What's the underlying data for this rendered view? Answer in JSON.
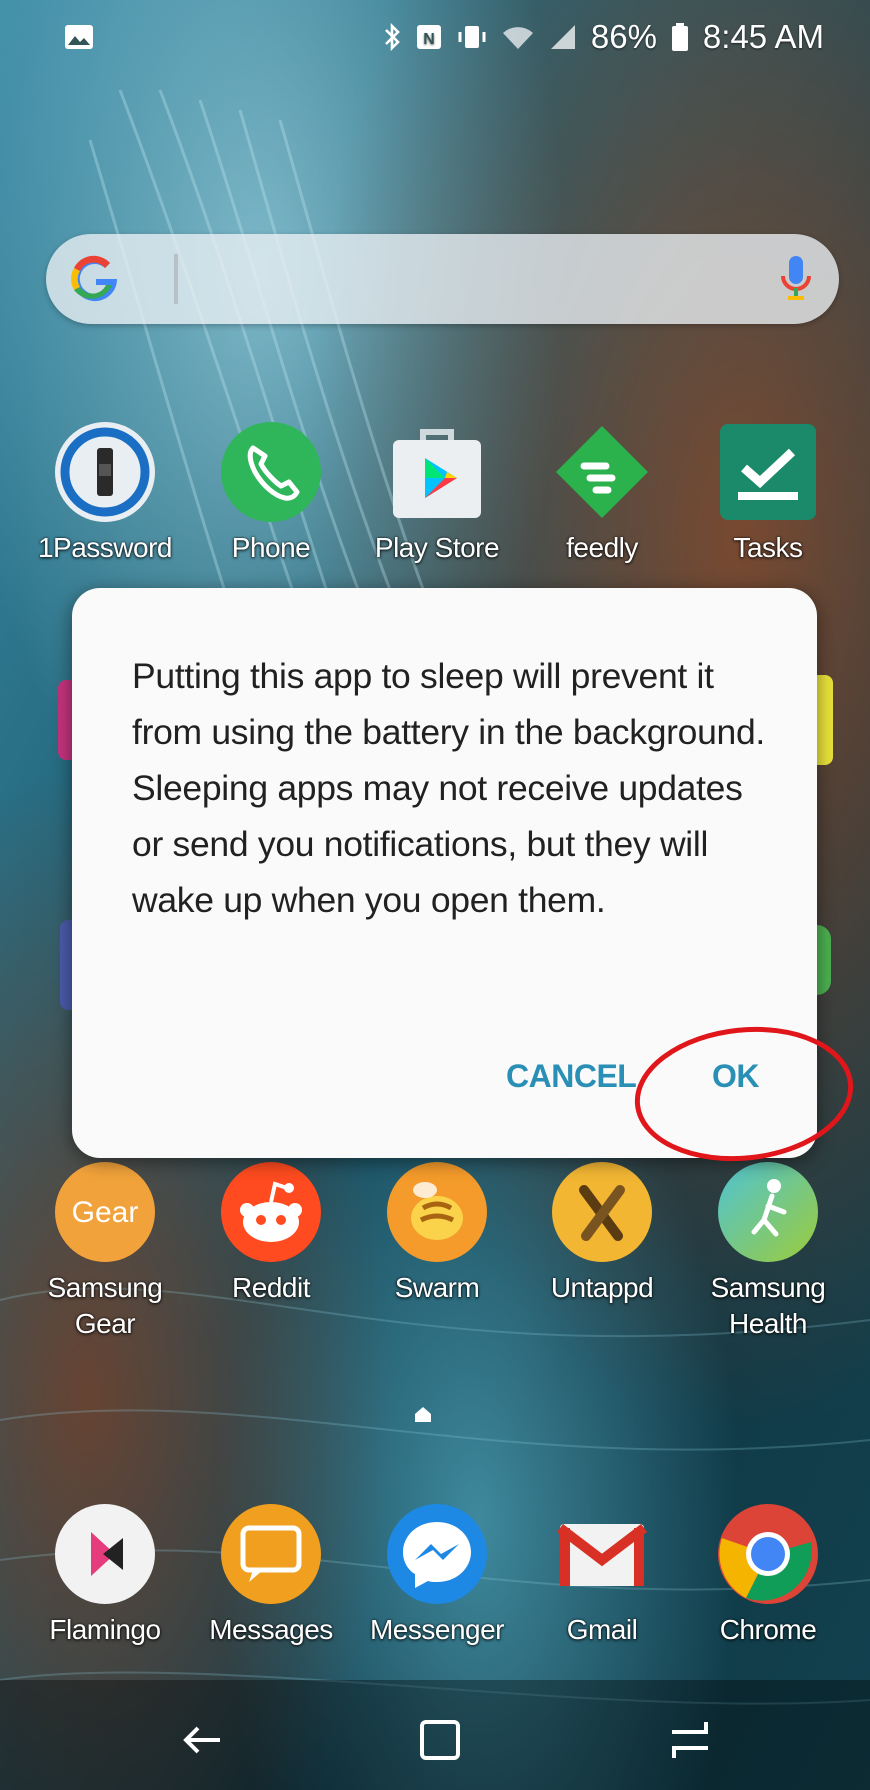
{
  "status_bar": {
    "battery": "86%",
    "time": "8:45 AM",
    "icons": [
      "picture-icon",
      "bluetooth-icon",
      "nfc-icon",
      "vibrate-icon",
      "wifi-icon",
      "signal-icon",
      "battery-icon"
    ]
  },
  "search": {
    "left_icon": "google-g-icon",
    "right_icon": "mic-icon"
  },
  "apps": {
    "row1": [
      {
        "label": "1Password",
        "icon": "onepassword-icon"
      },
      {
        "label": "Phone",
        "icon": "phone-icon"
      },
      {
        "label": "Play Store",
        "icon": "play-store-icon"
      },
      {
        "label": "feedly",
        "icon": "feedly-icon"
      },
      {
        "label": "Tasks",
        "icon": "tasks-icon"
      }
    ],
    "row4": [
      {
        "label": "Samsung Gear",
        "icon": "samsung-gear-icon"
      },
      {
        "label": "Reddit",
        "icon": "reddit-icon"
      },
      {
        "label": "Swarm",
        "icon": "swarm-icon"
      },
      {
        "label": "Untappd",
        "icon": "untappd-icon"
      },
      {
        "label": "Samsung Health",
        "icon": "samsung-health-icon"
      }
    ],
    "dock": [
      {
        "label": "Flamingo",
        "icon": "flamingo-icon"
      },
      {
        "label": "Messages",
        "icon": "messages-icon"
      },
      {
        "label": "Messenger",
        "icon": "messenger-icon"
      },
      {
        "label": "Gmail",
        "icon": "gmail-icon"
      },
      {
        "label": "Chrome",
        "icon": "chrome-icon"
      }
    ]
  },
  "gear_icon_text": "Gear",
  "dialog": {
    "message": "Putting this app to sleep will prevent it from using the battery in the background. Sleeping apps may not receive updates or send you notifications, but they will wake up when you open them.",
    "cancel_label": "CANCEL",
    "ok_label": "OK"
  },
  "navbar": {
    "icons": [
      "back-icon",
      "home-icon",
      "recents-icon"
    ]
  },
  "colors": {
    "dialog_button": "#2a8fb5",
    "annotation": "#e0161b"
  }
}
